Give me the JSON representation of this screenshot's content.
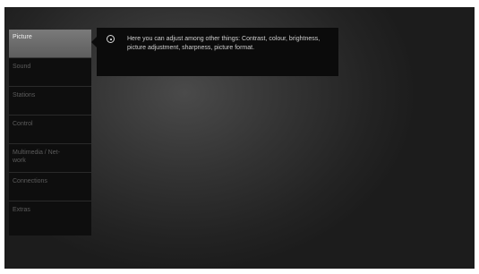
{
  "menu": {
    "items": [
      {
        "label": "Picture",
        "active": true
      },
      {
        "label": "Sound"
      },
      {
        "label": "Stations"
      },
      {
        "label": "Control"
      },
      {
        "label": "Multimedia / Net-\nwork"
      },
      {
        "label": "Connections"
      },
      {
        "label": "Extras"
      }
    ]
  },
  "info": {
    "icon": "info-icon",
    "text": "Here you can adjust among other things: Contrast, colour, brightness, picture adjustment, sharpness, picture format."
  }
}
